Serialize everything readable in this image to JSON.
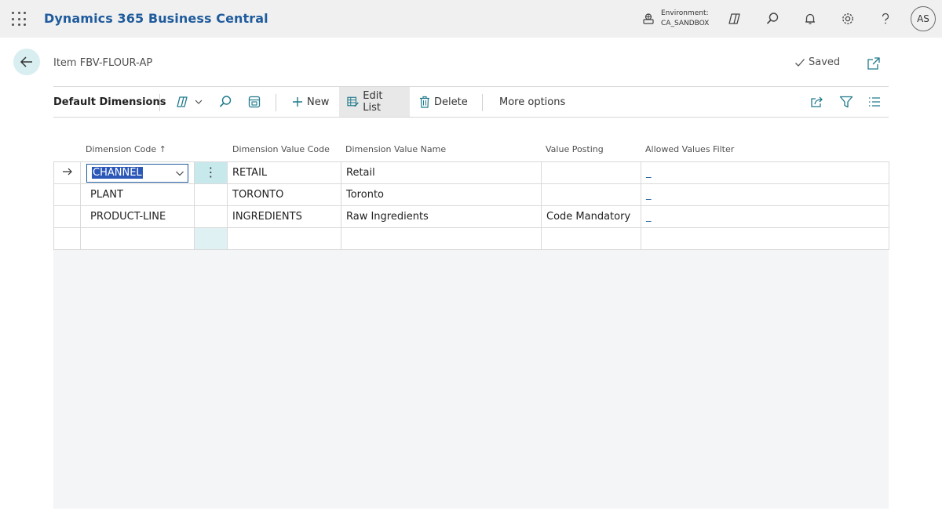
{
  "app": {
    "title": "Dynamics 365 Business Central"
  },
  "environment": {
    "label": "Environment:",
    "value": "CA_SANDBOX"
  },
  "user": {
    "initials": "AS"
  },
  "page": {
    "title": "Item FBV-FLOUR-AP",
    "status": "Saved"
  },
  "actions": {
    "title": "Default Dimensions",
    "new": "New",
    "edit_list": "Edit List",
    "delete": "Delete",
    "more": "More options"
  },
  "columns": {
    "dimension_code": "Dimension Code",
    "sort_indicator": "↑",
    "dimension_value_code": "Dimension Value Code",
    "dimension_value_name": "Dimension Value Name",
    "value_posting": "Value Posting",
    "allowed_values_filter": "Allowed Values Filter"
  },
  "rows": [
    {
      "dimension_code": "CHANNEL",
      "dimension_value_code": "RETAIL",
      "dimension_value_name": "Retail",
      "value_posting": "",
      "allowed_values_filter": "_"
    },
    {
      "dimension_code": "PLANT",
      "dimension_value_code": "TORONTO",
      "dimension_value_name": "Toronto",
      "value_posting": "",
      "allowed_values_filter": "_"
    },
    {
      "dimension_code": "PRODUCT-LINE",
      "dimension_value_code": "INGREDIENTS",
      "dimension_value_name": "Raw Ingredients",
      "value_posting": "Code Mandatory",
      "allowed_values_filter": "_"
    },
    {
      "dimension_code": "",
      "dimension_value_code": "",
      "dimension_value_name": "",
      "value_posting": "",
      "allowed_values_filter": ""
    }
  ],
  "colors": {
    "brand": "#1f5b9c",
    "selection": "#2b58b8",
    "accent_cell": "#c7e9ec",
    "app_bar": "#f0f0f0"
  },
  "icons": [
    "waffle-icon",
    "environment-icon",
    "copilot-icon",
    "search-icon",
    "bell-icon",
    "gear-icon",
    "help-icon",
    "back-arrow-icon",
    "checkmark-icon",
    "popout-icon",
    "analyze-icon",
    "personalize-icon",
    "plus-icon",
    "edit-list-icon",
    "trash-icon",
    "share-icon",
    "filter-icon",
    "list-view-icon",
    "row-arrow-icon",
    "chevron-down-icon",
    "kebab-icon"
  ]
}
